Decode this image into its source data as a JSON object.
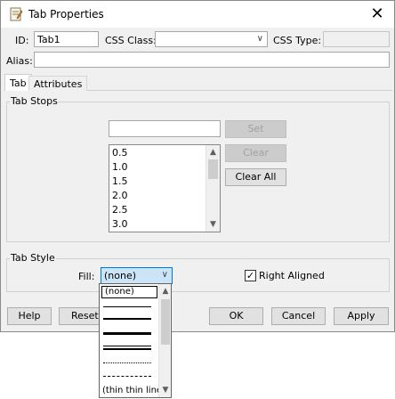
{
  "window": {
    "title": "Tab Properties",
    "close_glyph": "✕"
  },
  "form": {
    "id_label": "ID:",
    "id_value": "Tab1",
    "css_class_label": "CSS Class:",
    "css_class_value": "",
    "css_type_label": "CSS Type:",
    "css_type_value": "",
    "alias_label": "Alias:",
    "alias_value": ""
  },
  "tabs": [
    {
      "label": "Tab",
      "active": true
    },
    {
      "label": "Attributes",
      "active": false
    }
  ],
  "tab_stops": {
    "group_label": "Tab Stops",
    "input_value": "",
    "set_label": "Set",
    "clear_label": "Clear",
    "clear_all_label": "Clear All",
    "list": [
      "0.5",
      "1.0",
      "1.5",
      "2.0",
      "2.5",
      "3.0"
    ]
  },
  "tab_style": {
    "group_label": "Tab Style",
    "fill_label": "Fill:",
    "fill_value": "(none)",
    "right_aligned_label": "Right Aligned",
    "right_aligned_checked": true
  },
  "fill_dropdown": {
    "options": [
      "(none)",
      "",
      "",
      "",
      "",
      "",
      "",
      "(thin thin line"
    ]
  },
  "buttons": {
    "help": "Help",
    "reset": "Reset",
    "ok": "OK",
    "cancel": "Cancel",
    "apply": "Apply"
  },
  "icons": {
    "check_glyph": "✓",
    "up_glyph": "▲",
    "down_glyph": "▼",
    "combo_glyph": "∨"
  },
  "colors": {
    "dialog_bg": "#f0f0f0",
    "selected_combo_bg": "#cce4f7",
    "highlight_border": "#0078d7"
  }
}
